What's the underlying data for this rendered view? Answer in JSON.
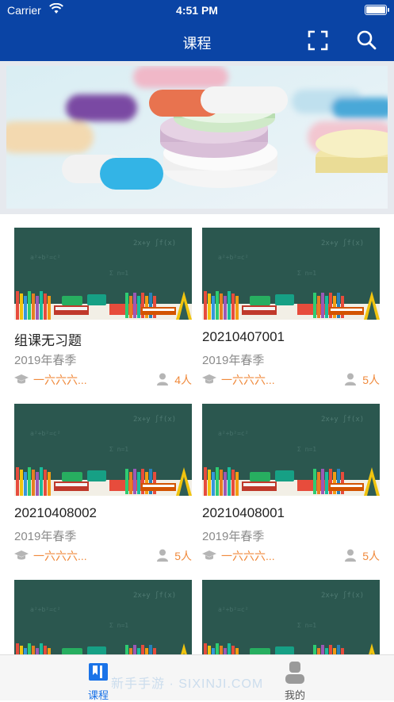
{
  "status_bar": {
    "carrier": "Carrier",
    "time": "4:51 PM"
  },
  "navbar": {
    "title": "课程",
    "icons": [
      "scan-icon",
      "search-icon"
    ]
  },
  "banner": {
    "image": "pills-banner"
  },
  "courses": [
    {
      "name": "组课无习题",
      "term": "2019年春季",
      "teacher": "一六六六...",
      "count": "4人"
    },
    {
      "name": "20210407001",
      "term": "2019年春季",
      "teacher": "一六六六...",
      "count": "5人"
    },
    {
      "name": "20210408002",
      "term": "2019年春季",
      "teacher": "一六六六...",
      "count": "5人"
    },
    {
      "name": "20210408001",
      "term": "2019年春季",
      "teacher": "一六六六...",
      "count": "5人"
    },
    {
      "name": "",
      "term": "",
      "teacher": "",
      "count": ""
    },
    {
      "name": "",
      "term": "",
      "teacher": "",
      "count": ""
    }
  ],
  "tabbar": {
    "tabs": [
      {
        "label": "课程",
        "icon": "book-icon",
        "active": true
      },
      {
        "label": "我的",
        "icon": "user-icon",
        "active": false
      }
    ]
  },
  "watermark": "新手手游 · SIXINJI.COM",
  "colors": {
    "primary": "#0a44a5",
    "accent": "#f08a3c",
    "tab_active": "#1a73e8",
    "tab_inactive": "#9a9a9a"
  }
}
